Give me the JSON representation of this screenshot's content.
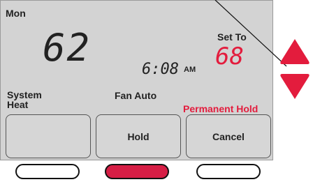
{
  "screen": {
    "day": "Mon",
    "indoor_temp": "62",
    "time": "6:08",
    "ampm": "AM",
    "set_to_label": "Set To",
    "set_to_value": "68",
    "system_label_line1": "System",
    "system_label_line2": "Heat",
    "fan_label": "Fan Auto",
    "hold_status": "Permanent Hold"
  },
  "softkeys": {
    "left": "",
    "middle": "Hold",
    "right": "Cancel"
  },
  "colors": {
    "accent_red": "#e31c3d",
    "screen_bg": "#d3d3d3"
  },
  "icons": {
    "up": "triangle-up-icon",
    "down": "triangle-down-icon"
  }
}
